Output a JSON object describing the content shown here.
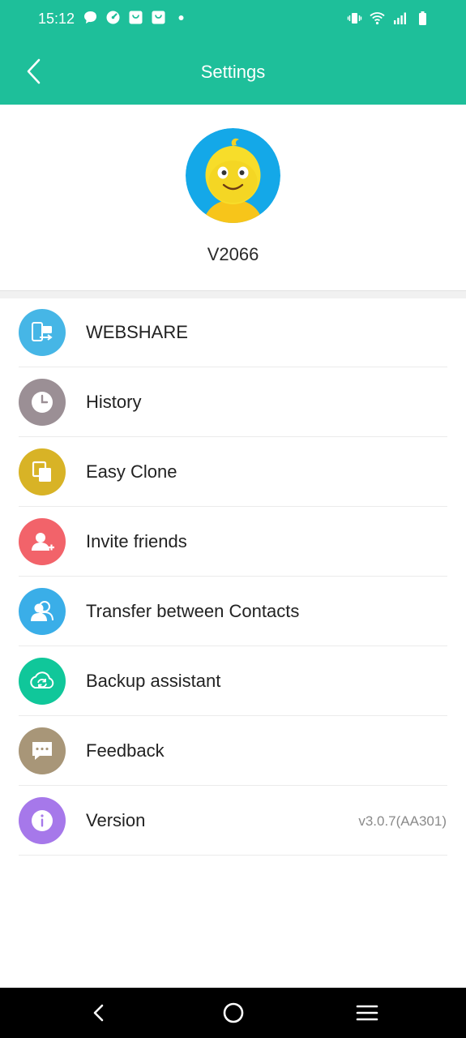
{
  "status_bar": {
    "time": "15:12",
    "left_icons": [
      "chat-icon",
      "speedometer-icon",
      "shopping-bag-icon",
      "shopping-bag-icon",
      "dot-icon"
    ],
    "right_icons": [
      "vibrate-icon",
      "wifi-icon",
      "signal-icon",
      "battery-icon"
    ]
  },
  "app_bar": {
    "title": "Settings",
    "back_icon": "chevron-left-icon",
    "background": "#1ebf9a"
  },
  "profile": {
    "device_name": "V2066",
    "avatar_icon": "duck-avatar-icon"
  },
  "menu": {
    "items": [
      {
        "label": "WEBSHARE",
        "icon": "webshare-icon",
        "color": "#46b6e6"
      },
      {
        "label": "History",
        "icon": "clock-icon",
        "color": "#9b8f95"
      },
      {
        "label": "Easy Clone",
        "icon": "clone-icon",
        "color": "#d8b326"
      },
      {
        "label": "Invite friends",
        "icon": "add-user-icon",
        "color": "#f2636a"
      },
      {
        "label": "Transfer between Contacts",
        "icon": "contacts-icon",
        "color": "#3aaee8"
      },
      {
        "label": "Backup assistant",
        "icon": "cloud-sync-icon",
        "color": "#10c79a"
      },
      {
        "label": "Feedback",
        "icon": "message-icon",
        "color": "#a89678"
      },
      {
        "label": "Version",
        "icon": "info-icon",
        "color": "#a678ea",
        "value": "v3.0.7(AA301)"
      }
    ]
  },
  "nav_bar": {
    "buttons": [
      "back-triangle-icon",
      "home-circle-icon",
      "menu-lines-icon"
    ]
  }
}
